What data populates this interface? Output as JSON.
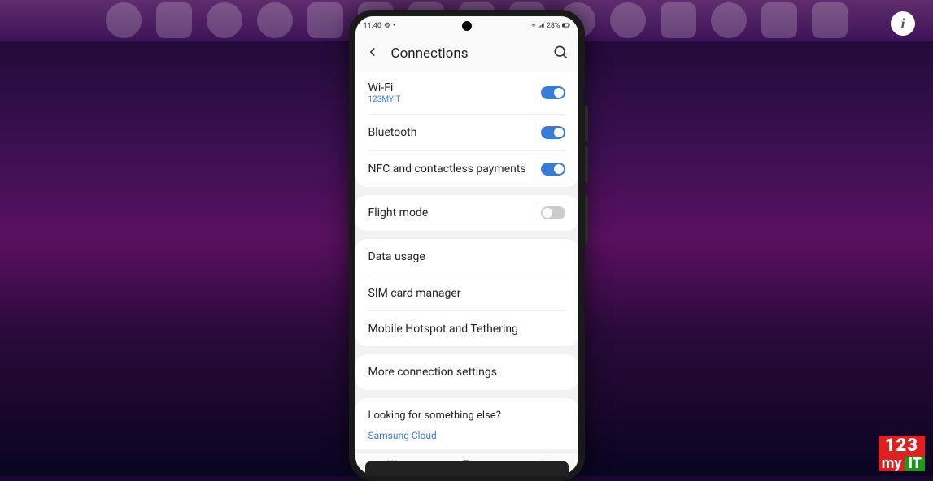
{
  "status_bar": {
    "time": "11:40",
    "battery_text": "28%"
  },
  "header": {
    "title": "Connections"
  },
  "groups": [
    {
      "rows": [
        {
          "label": "Wi-Fi",
          "sub": "123MYIT",
          "toggle": true,
          "on": true
        },
        {
          "label": "Bluetooth",
          "toggle": true,
          "on": true
        },
        {
          "label": "NFC and contactless payments",
          "toggle": true,
          "on": true
        }
      ]
    },
    {
      "rows": [
        {
          "label": "Flight mode",
          "toggle": true,
          "on": false
        }
      ]
    },
    {
      "rows": [
        {
          "label": "Data usage",
          "toggle": false
        },
        {
          "label": "SIM card manager",
          "toggle": false
        },
        {
          "label": "Mobile Hotspot and Tethering",
          "toggle": false
        }
      ]
    },
    {
      "rows": [
        {
          "label": "More connection settings",
          "toggle": false
        }
      ]
    }
  ],
  "footer": {
    "prompt": "Looking for something else?",
    "link": "Samsung Cloud"
  },
  "watermark": {
    "top": "123",
    "my": "my",
    "it": "IT"
  },
  "info_badge": "i"
}
